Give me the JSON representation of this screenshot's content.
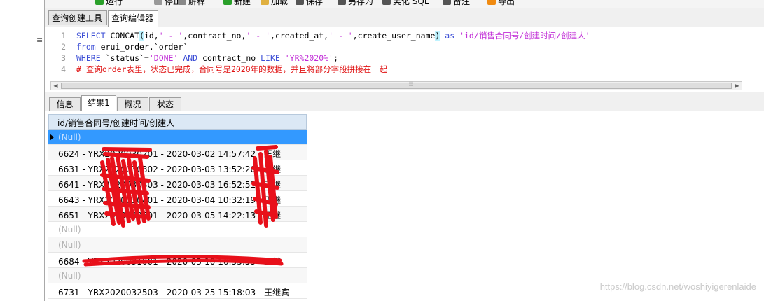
{
  "toolbar": {
    "items": [
      {
        "label": "运行",
        "icon": "run-icon",
        "color": "#2aa02a"
      },
      {
        "label": "停止",
        "icon": "stop-icon",
        "color": "#999999"
      },
      {
        "label": "解释",
        "icon": "explain-icon",
        "color": "#888888"
      },
      {
        "label": "新建",
        "icon": "new-icon",
        "color": "#2aa02a"
      },
      {
        "label": "加载",
        "icon": "load-icon",
        "color": "#e0b040"
      },
      {
        "label": "保存",
        "icon": "save-icon",
        "color": "#555555"
      },
      {
        "label": "另存为",
        "icon": "save-as-icon",
        "color": "#555555"
      },
      {
        "label": "美化 SQL",
        "icon": "beautify-icon",
        "color": "#555555"
      },
      {
        "label": "备注",
        "icon": "comment-icon",
        "color": "#555555"
      },
      {
        "label": "导出",
        "icon": "export-icon",
        "color": "#f08a10"
      }
    ]
  },
  "top_tabs": [
    {
      "label": "查询创建工具"
    },
    {
      "label": "查询编辑器"
    }
  ],
  "editor": {
    "lines": [
      {
        "num": "1",
        "tokens": [
          {
            "t": "SELECT ",
            "c": "kw"
          },
          {
            "t": "CONCAT",
            "c": "plain"
          },
          {
            "t": "(",
            "c": "paren"
          },
          {
            "t": "id,",
            "c": "plain"
          },
          {
            "t": "' - '",
            "c": "str"
          },
          {
            "t": ",contract_no,",
            "c": "plain"
          },
          {
            "t": "' - '",
            "c": "str"
          },
          {
            "t": ",created_at,",
            "c": "plain"
          },
          {
            "t": "' - '",
            "c": "str"
          },
          {
            "t": ",create_user_name",
            "c": "plain"
          },
          {
            "t": ")",
            "c": "paren"
          },
          {
            "t": " as ",
            "c": "kw"
          },
          {
            "t": "'id/销售合同号/创建时间/创建人'",
            "c": "str"
          }
        ]
      },
      {
        "num": "2",
        "tokens": [
          {
            "t": "from ",
            "c": "kw"
          },
          {
            "t": "erui_order.`order`",
            "c": "plain"
          }
        ]
      },
      {
        "num": "3",
        "tokens": [
          {
            "t": "WHERE ",
            "c": "kw"
          },
          {
            "t": "`status`=",
            "c": "plain"
          },
          {
            "t": "'DONE'",
            "c": "str"
          },
          {
            "t": " AND ",
            "c": "kw"
          },
          {
            "t": "contract_no ",
            "c": "plain"
          },
          {
            "t": "LIKE ",
            "c": "kw"
          },
          {
            "t": "'YR%2020%'",
            "c": "str"
          },
          {
            "t": ";",
            "c": "plain"
          }
        ]
      },
      {
        "num": "4",
        "tokens": [
          {
            "t": "# 查询order表里，状态已完成，合同号是2020年的数据，并且将部分字段拼接在一起",
            "c": "cmt"
          }
        ]
      }
    ]
  },
  "result_tabs": [
    {
      "label": "信息"
    },
    {
      "label": "结果1"
    },
    {
      "label": "概况"
    },
    {
      "label": "状态"
    }
  ],
  "grid": {
    "column_header": "id/销售合同号/创建时间/创建人",
    "rows": [
      {
        "value": "(Null)",
        "null": true,
        "selected": true
      },
      {
        "value": "6624 - YRX2020030201 - 2020-03-02 14:57:42 - 王继"
      },
      {
        "value": "6631 - YRX2020030302 - 2020-03-03 13:52:20 - 王继"
      },
      {
        "value": "6641 - YRX2020030303 - 2020-03-03 16:52:51 - 王继"
      },
      {
        "value": "6643 - YRX2020030401 - 2020-03-04 10:32:19 - 王继"
      },
      {
        "value": "6651 - YRX2020030501 - 2020-03-05 14:22:13 - 王继"
      },
      {
        "value": "(Null)",
        "null": true
      },
      {
        "value": "(Null)",
        "null": true
      },
      {
        "value": "6684 - YRX2020031001 - 2020-03-10 16:55:55 - 王继"
      },
      {
        "value": "(Null)",
        "null": true
      },
      {
        "value": "6731 - YRX2020032503 - 2020-03-25 15:18:03 - 王继宾"
      }
    ]
  },
  "watermark": "https://blog.csdn.net/woshiyigerenlaide",
  "colors": {
    "keyword": "#3d4fd6",
    "string": "#c02bd6",
    "comment": "#e01010",
    "selected_row": "#3399ff",
    "header_bg": "#dbe8f5",
    "redaction": "#e8101a"
  }
}
